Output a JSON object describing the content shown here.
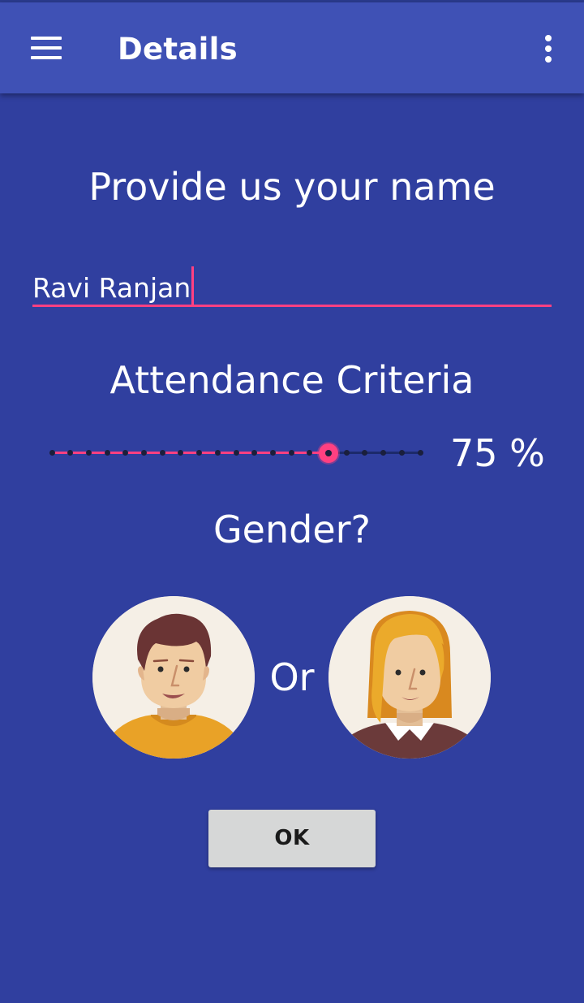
{
  "toolbar": {
    "title": "Details",
    "menu_icon": "hamburger-menu-icon",
    "overflow_icon": "more-vertical-icon",
    "color": "#3F51B5"
  },
  "name_section": {
    "heading": "Provide us your name",
    "input_value": "Ravi Ranjan",
    "underline_color": "#FF4081"
  },
  "attendance_section": {
    "heading": "Attendance Criteria",
    "value_label": "75 %",
    "value_percent": 75,
    "tick_count": 21,
    "selected_tick_index": 15,
    "accent_color": "#FF4081"
  },
  "gender_section": {
    "heading": "Gender?",
    "separator": "Or",
    "options": [
      {
        "id": "male",
        "icon": "male-avatar-icon"
      },
      {
        "id": "female",
        "icon": "female-avatar-icon"
      }
    ]
  },
  "ok_button": {
    "label": "OK"
  },
  "theme": {
    "background": "#303F9F",
    "primary": "#3F51B5",
    "accent": "#FF4081",
    "button_background": "#D6D7D7"
  }
}
